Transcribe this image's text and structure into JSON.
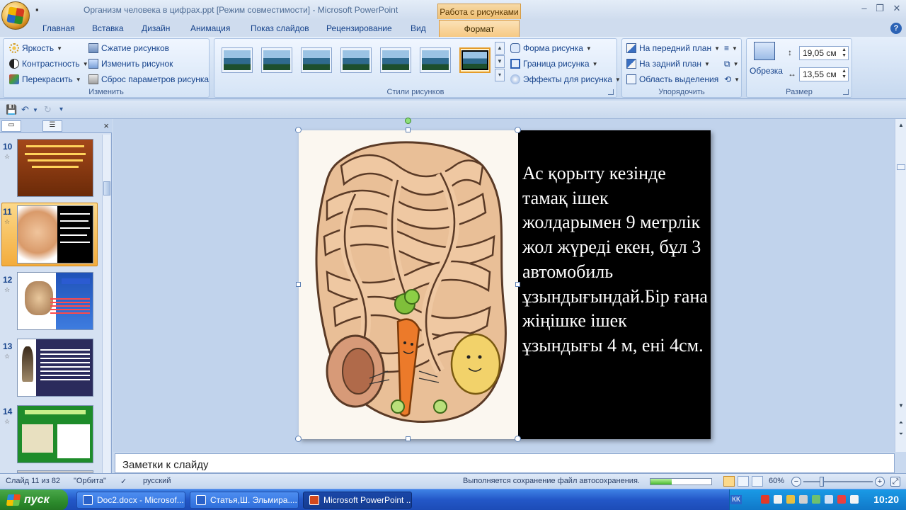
{
  "window": {
    "title": "Организм человека в цифрах.ppt [Режим совместимости] - Microsoft PowerPoint",
    "context_tab_header": "Работа с рисунками"
  },
  "tabs": [
    "Главная",
    "Вставка",
    "Дизайн",
    "Анимация",
    "Показ слайдов",
    "Рецензирование",
    "Вид"
  ],
  "active_tab": "Формат",
  "ribbon": {
    "adjust": {
      "label": "Изменить",
      "brightness": "Яркость",
      "contrast": "Контрастность",
      "recolor": "Перекрасить",
      "compress": "Сжатие рисунков",
      "change_picture": "Изменить рисунок",
      "reset": "Сброс параметров рисунка"
    },
    "styles": {
      "label": "Стили рисунков",
      "shape": "Форма рисунка",
      "border": "Граница рисунка",
      "effects": "Эффекты для рисунка"
    },
    "arrange": {
      "label": "Упорядочить",
      "bring_front": "На передний план",
      "send_back": "На задний план",
      "selection_pane": "Область выделения"
    },
    "size": {
      "label": "Размер",
      "crop": "Обрезка",
      "height": "19,05 см",
      "width": "13,55 см"
    }
  },
  "slides": [
    {
      "num": "10",
      "bg": "#8a3a10"
    },
    {
      "num": "11",
      "bg": "#ffffff"
    },
    {
      "num": "12",
      "bg": "#ffffff"
    },
    {
      "num": "13",
      "bg": "#2b2b5c"
    },
    {
      "num": "14",
      "bg": "#1e8c2a"
    }
  ],
  "slide_content": {
    "text": "Ас қорыту кезінде тамақ ішек жолдарымен 9 метрлік жол жүреді екен, бұл 3 автомобиль ұзындығындай.Бір ғана жіңішке ішек ұзындығы 4 м, ені 4см."
  },
  "notes_placeholder": "Заметки к слайду",
  "status": {
    "slide_counter": "Слайд 11 из 82",
    "theme": "\"Орбита\"",
    "language": "русский",
    "autosave": "Выполняется сохранение файл автосохранения.",
    "autosave_progress": 0.35,
    "zoom": "60%"
  },
  "taskbar": {
    "start": "пуск",
    "tasks": [
      "Doc2.docx - Microsof...",
      "Статья,Ш. Эльмира....",
      "Microsoft PowerPoint ..."
    ],
    "lang": "КК",
    "clock": "10:20"
  }
}
